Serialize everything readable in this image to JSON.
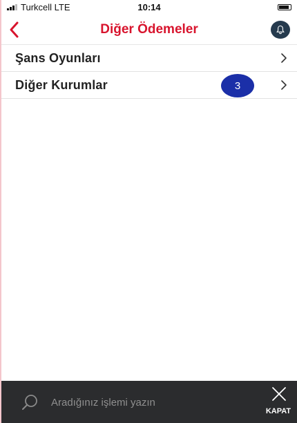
{
  "status_bar": {
    "carrier": "Turkcell  LTE",
    "time": "10:14"
  },
  "nav": {
    "back_icon": "chevron-left-icon",
    "title": "Diğer Ödemeler",
    "notification_icon": "bell-icon",
    "accent_color": "#d8142d"
  },
  "list": {
    "items": [
      {
        "label": "Şans Oyunları"
      },
      {
        "label": "Diğer Kurumlar"
      }
    ],
    "badge": "3",
    "badge_color": "#1b2fa8"
  },
  "bottom_bar": {
    "search_placeholder": "Aradığınız işlemi yazın",
    "close_label": "KAPAT",
    "background": "#2b2c2e"
  }
}
